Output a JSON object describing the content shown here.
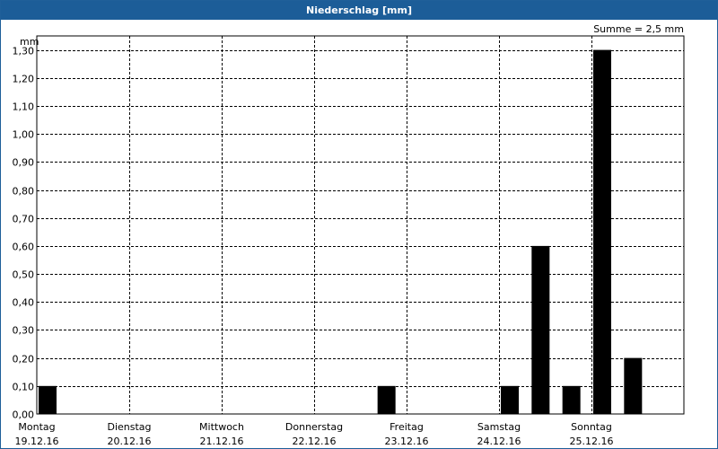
{
  "window": {
    "title": "Niederschlag [mm]"
  },
  "chart_data": {
    "type": "bar",
    "title": "Niederschlag [mm]",
    "annotation": "Summe = 2,5 mm",
    "ylabel": "mm",
    "xlabel": "",
    "ylim": [
      0,
      1.35
    ],
    "yticks": [
      "0,00",
      "0,10",
      "0,20",
      "0,30",
      "0,40",
      "0,50",
      "0,60",
      "0,70",
      "0,80",
      "0,90",
      "1,00",
      "1,10",
      "1,20",
      "1,30"
    ],
    "grid": true,
    "days": [
      {
        "name": "Montag",
        "date": "19.12.16"
      },
      {
        "name": "Dienstag",
        "date": "20.12.16"
      },
      {
        "name": "Mittwoch",
        "date": "21.12.16"
      },
      {
        "name": "Donnerstag",
        "date": "22.12.16"
      },
      {
        "name": "Freitag",
        "date": "23.12.16"
      },
      {
        "name": "Samstag",
        "date": "24.12.16"
      },
      {
        "name": "Sonntag",
        "date": "25.12.16"
      }
    ],
    "interval_per_day": 3,
    "values": [
      {
        "day": 0,
        "slot": 0,
        "value": 0.1
      },
      {
        "day": 3,
        "slot": 2,
        "value": 0.1
      },
      {
        "day": 5,
        "slot": 0,
        "value": 0.1
      },
      {
        "day": 5,
        "slot": 1,
        "value": 0.6
      },
      {
        "day": 5,
        "slot": 2,
        "value": 0.1
      },
      {
        "day": 6,
        "slot": 0,
        "value": 1.3
      },
      {
        "day": 6,
        "slot": 1,
        "value": 0.2
      }
    ],
    "bar_color": "#000000"
  }
}
